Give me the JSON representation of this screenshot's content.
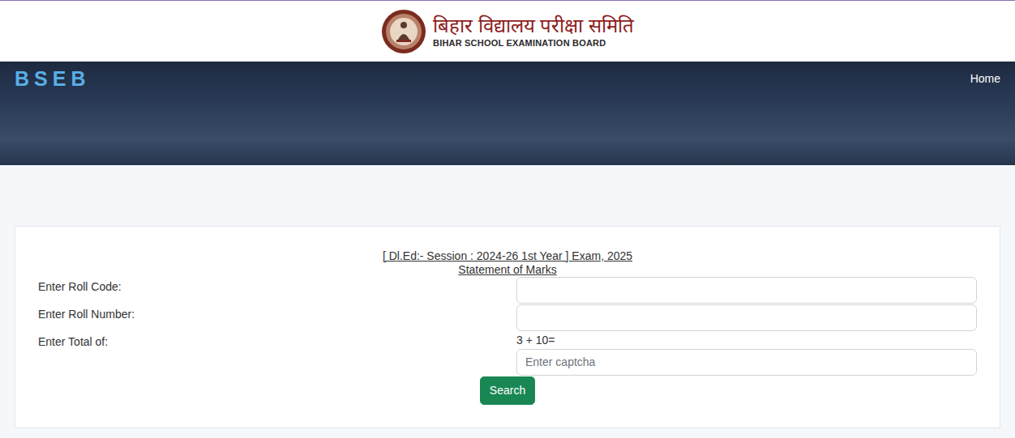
{
  "header": {
    "title_hi": "बिहार विद्यालय परीक्षा समिति",
    "title_en": "BIHAR SCHOOL EXAMINATION BOARD"
  },
  "navbar": {
    "brand": "BSEB",
    "links": [
      "Home"
    ]
  },
  "form": {
    "title": "[ Dl.Ed:- Session : 2024-26 1st Year ] Exam, 2025",
    "subtitle": "Statement of Marks",
    "fields": [
      {
        "label": "Enter Roll Code:"
      },
      {
        "label": "Enter Roll Number:"
      }
    ],
    "captcha": {
      "label": "Enter Total of:",
      "question": "3 + 10=",
      "placeholder": "Enter captcha"
    },
    "button": "Search"
  }
}
